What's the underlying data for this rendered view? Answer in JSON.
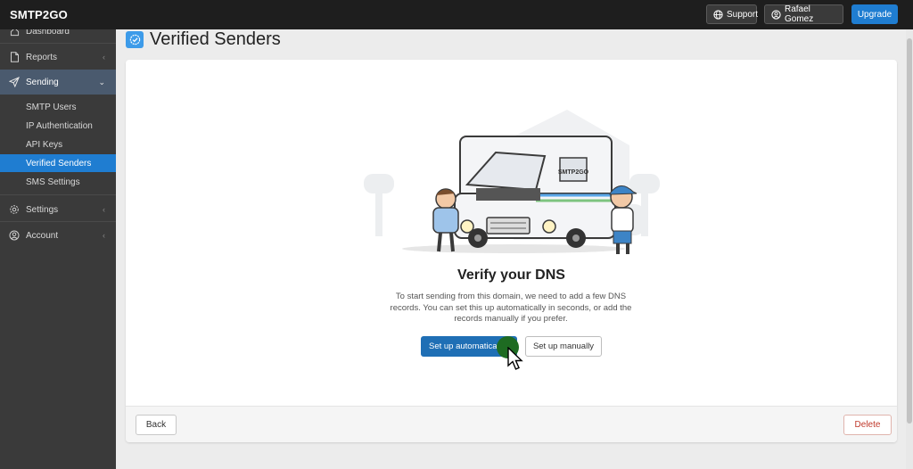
{
  "app": {
    "logo_text": "SMTP2GO"
  },
  "topbar": {
    "support_label": "Support",
    "user_label": "Rafael Gomez",
    "upgrade_label": "Upgrade"
  },
  "sidebar": {
    "items": [
      {
        "label": "Dashboard",
        "icon": "home-icon"
      },
      {
        "label": "Reports",
        "icon": "document-icon"
      },
      {
        "label": "Sending",
        "icon": "paper-plane-icon",
        "expanded": true
      },
      {
        "label": "Settings",
        "icon": "gear-icon"
      },
      {
        "label": "Account",
        "icon": "user-circle-icon"
      }
    ],
    "sending_subitems": [
      {
        "label": "SMTP Users"
      },
      {
        "label": "IP Authentication"
      },
      {
        "label": "API Keys"
      },
      {
        "label": "Verified Senders",
        "active": true
      },
      {
        "label": "SMS Settings"
      }
    ]
  },
  "page": {
    "title": "Verified Senders",
    "title_icon": "verified-badge-icon"
  },
  "verify": {
    "heading": "Verify your DNS",
    "description": "To start sending from this domain, we need to add a few DNS records. You can set this up automatically in seconds, or add the records manually if you prefer.",
    "auto_button": "Set up automatically",
    "manual_button": "Set up manually",
    "van_text": "SMTP2GO"
  },
  "footer": {
    "back_label": "Back",
    "delete_label": "Delete"
  },
  "colors": {
    "brand_blue": "#1f7dd1",
    "sidebar_bg": "#3a3a3a",
    "topbar_bg": "#1e1e1e",
    "delete_red": "#c0392b"
  }
}
